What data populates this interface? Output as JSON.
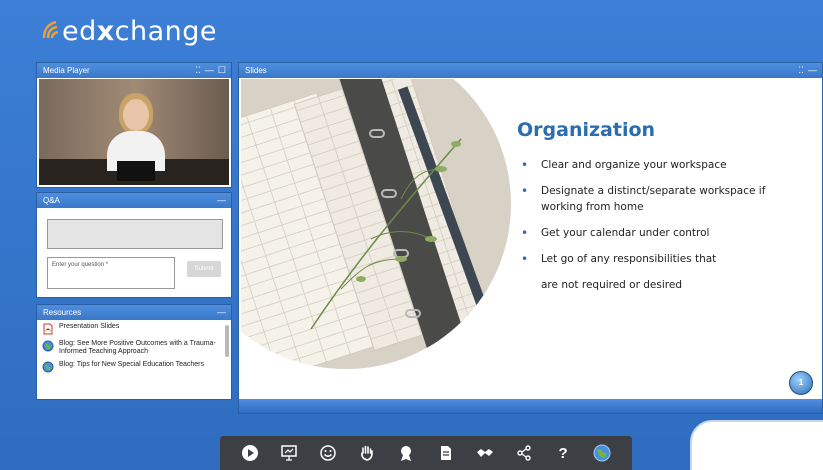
{
  "app": {
    "logo_text_ed": "ed",
    "logo_text_x": "x",
    "logo_text_change": "change"
  },
  "media_player": {
    "title": "Media Player"
  },
  "qa": {
    "title": "Q&A",
    "input_placeholder": "Enter your question *",
    "submit_label": "Submit"
  },
  "resources": {
    "title": "Resources",
    "items": [
      {
        "label": "Presentation Slides",
        "icon": "pdf-icon"
      },
      {
        "label": "Blog: See More Positive Outcomes with a Trauma-Informed Teaching Approach",
        "icon": "globe-icon"
      },
      {
        "label": "Blog: Tips for New Special Education Teachers",
        "icon": "globe-icon"
      }
    ]
  },
  "slides": {
    "title": "Slides",
    "slide_title": "Organization",
    "bullets": [
      "Clear and organize your workspace",
      "Designate a distinct/separate workspace if working from home",
      "Get your calendar under control",
      "Let go of any responsibilities that"
    ],
    "continuation": "are not required or desired",
    "logo_text": "1"
  },
  "toolbar": {
    "items": [
      "play-icon",
      "presentation-icon",
      "smiley-icon",
      "raise-hand-icon",
      "badge-icon",
      "document-icon",
      "handshake-icon",
      "share-icon",
      "help-icon",
      "globe-icon"
    ],
    "help_label": "?"
  },
  "colors": {
    "background": "#3576cc",
    "accent": "#2a6eb0",
    "toolbar": "#3c3f44"
  }
}
